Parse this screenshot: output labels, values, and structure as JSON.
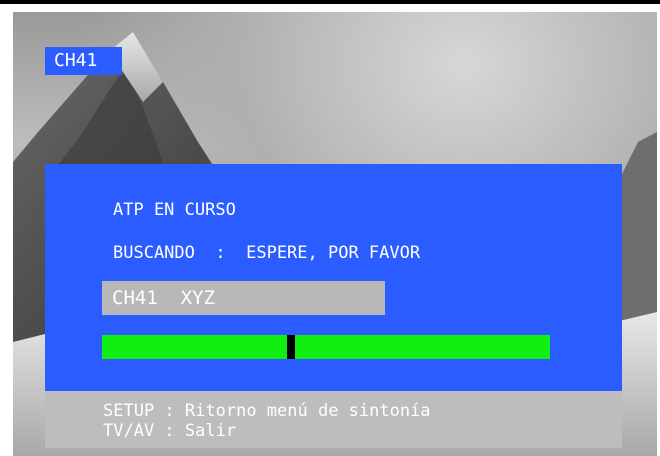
{
  "channel_badge": "CH41",
  "atp_panel": {
    "status_text": "ATP EN CURSO",
    "search_label": "BUSCANDO",
    "search_separator": ":",
    "search_message": "ESPERE, POR FAVOR",
    "channel_box_text": "CH41  XYZ",
    "progress": {
      "value": 0.42,
      "fill_color": "#11ee11",
      "marker_color": "#000000"
    }
  },
  "footer": {
    "line1_key": "SETUP",
    "line1_text": "Ritorno menú de sintonía",
    "line2_key": "TV/AV",
    "line2_text": "Salir"
  },
  "colors": {
    "panel_blue": "#2a5cff",
    "footer_gray": "#bdbdbd",
    "channel_box_gray": "#b8b8b8"
  },
  "icons": [
    "mountain-background-image"
  ]
}
